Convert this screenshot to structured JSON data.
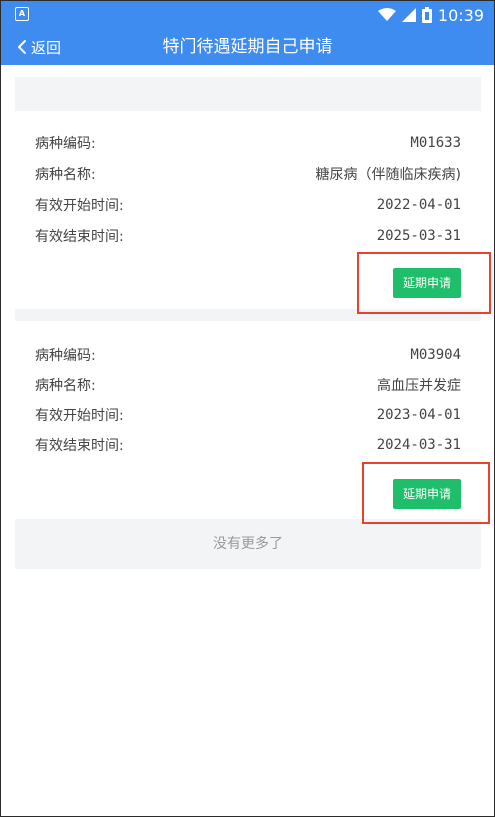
{
  "status_bar": {
    "notification_icon": "app-notification-icon",
    "notification_label": "A",
    "time": "10:39"
  },
  "header": {
    "back_label": "返回",
    "title": "特门待遇延期自己申请"
  },
  "records": [
    {
      "code_label": "病种编码:",
      "code_value": "M01633",
      "name_label": "病种名称:",
      "name_value": "糖尿病（伴随临床疾病)",
      "start_label": "有效开始时间:",
      "start_value": "2022-04-01",
      "end_label": "有效结束时间:",
      "end_value": "2025-03-31",
      "button_label": "延期申请"
    },
    {
      "code_label": "病种编码:",
      "code_value": "M03904",
      "name_label": "病种名称:",
      "name_value": "高血压并发症",
      "start_label": "有效开始时间:",
      "start_value": "2023-04-01",
      "end_label": "有效结束时间:",
      "end_value": "2024-03-31",
      "button_label": "延期申请"
    }
  ],
  "footer": {
    "no_more_text": "没有更多了"
  },
  "colors": {
    "header_bg": "#3f8cf0",
    "button_bg": "#1fbe6a",
    "highlight": "#e8412f"
  }
}
